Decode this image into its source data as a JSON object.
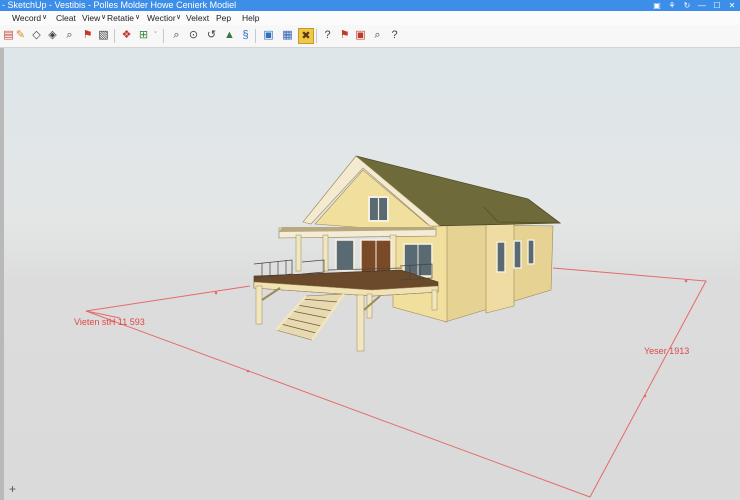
{
  "window": {
    "title": "- SketchUp - Vestibis - Polles Molder Howe Cenierk Modiel",
    "controls": [
      "▣",
      "⚘",
      "↻",
      "—",
      "☐",
      "✕"
    ]
  },
  "menu": {
    "items": [
      "Wecord",
      "Cleat",
      "View",
      "Retatie",
      "Wectior",
      "Velext",
      "Pep",
      "Help"
    ],
    "carets": [
      "∨",
      "∨",
      "∨",
      "∨"
    ]
  },
  "toolbar": {
    "dropdown_glyph": "ˇ",
    "tools": [
      {
        "name": "paint-icon",
        "glyph": "▤"
      },
      {
        "name": "pencil-icon",
        "glyph": "✎"
      },
      {
        "name": "eraser-icon",
        "glyph": "◇"
      },
      {
        "name": "shape-icon",
        "glyph": "◈"
      },
      {
        "name": "zoom-icon",
        "glyph": "⌕"
      },
      {
        "name": "flag-icon",
        "glyph": "⚑"
      },
      {
        "name": "image-icon",
        "glyph": "▧"
      },
      {
        "name": "components-icon",
        "glyph": "❖"
      },
      {
        "name": "add-icon",
        "glyph": "⊞"
      },
      {
        "name": "search-icon",
        "glyph": "⌕"
      },
      {
        "name": "orbit-icon",
        "glyph": "⊙"
      },
      {
        "name": "rotate-icon",
        "glyph": "↺"
      },
      {
        "name": "paint-bucket-icon",
        "glyph": "▲"
      },
      {
        "name": "sandbox-icon",
        "glyph": "§"
      },
      {
        "name": "save-icon",
        "glyph": "▣"
      },
      {
        "name": "grid-icon",
        "glyph": "▦"
      },
      {
        "name": "tools-icon",
        "glyph": "✖"
      },
      {
        "name": "help-icon",
        "glyph": "?"
      },
      {
        "name": "mark-icon",
        "glyph": "⚑"
      },
      {
        "name": "layer-icon",
        "glyph": "▣"
      },
      {
        "name": "find-icon",
        "glyph": "⌕"
      },
      {
        "name": "question-icon",
        "glyph": "?"
      }
    ]
  },
  "viewport": {
    "labels": [
      "Vieten stH 11 593",
      "Yeser 1913"
    ],
    "corner_glyph": "+"
  }
}
